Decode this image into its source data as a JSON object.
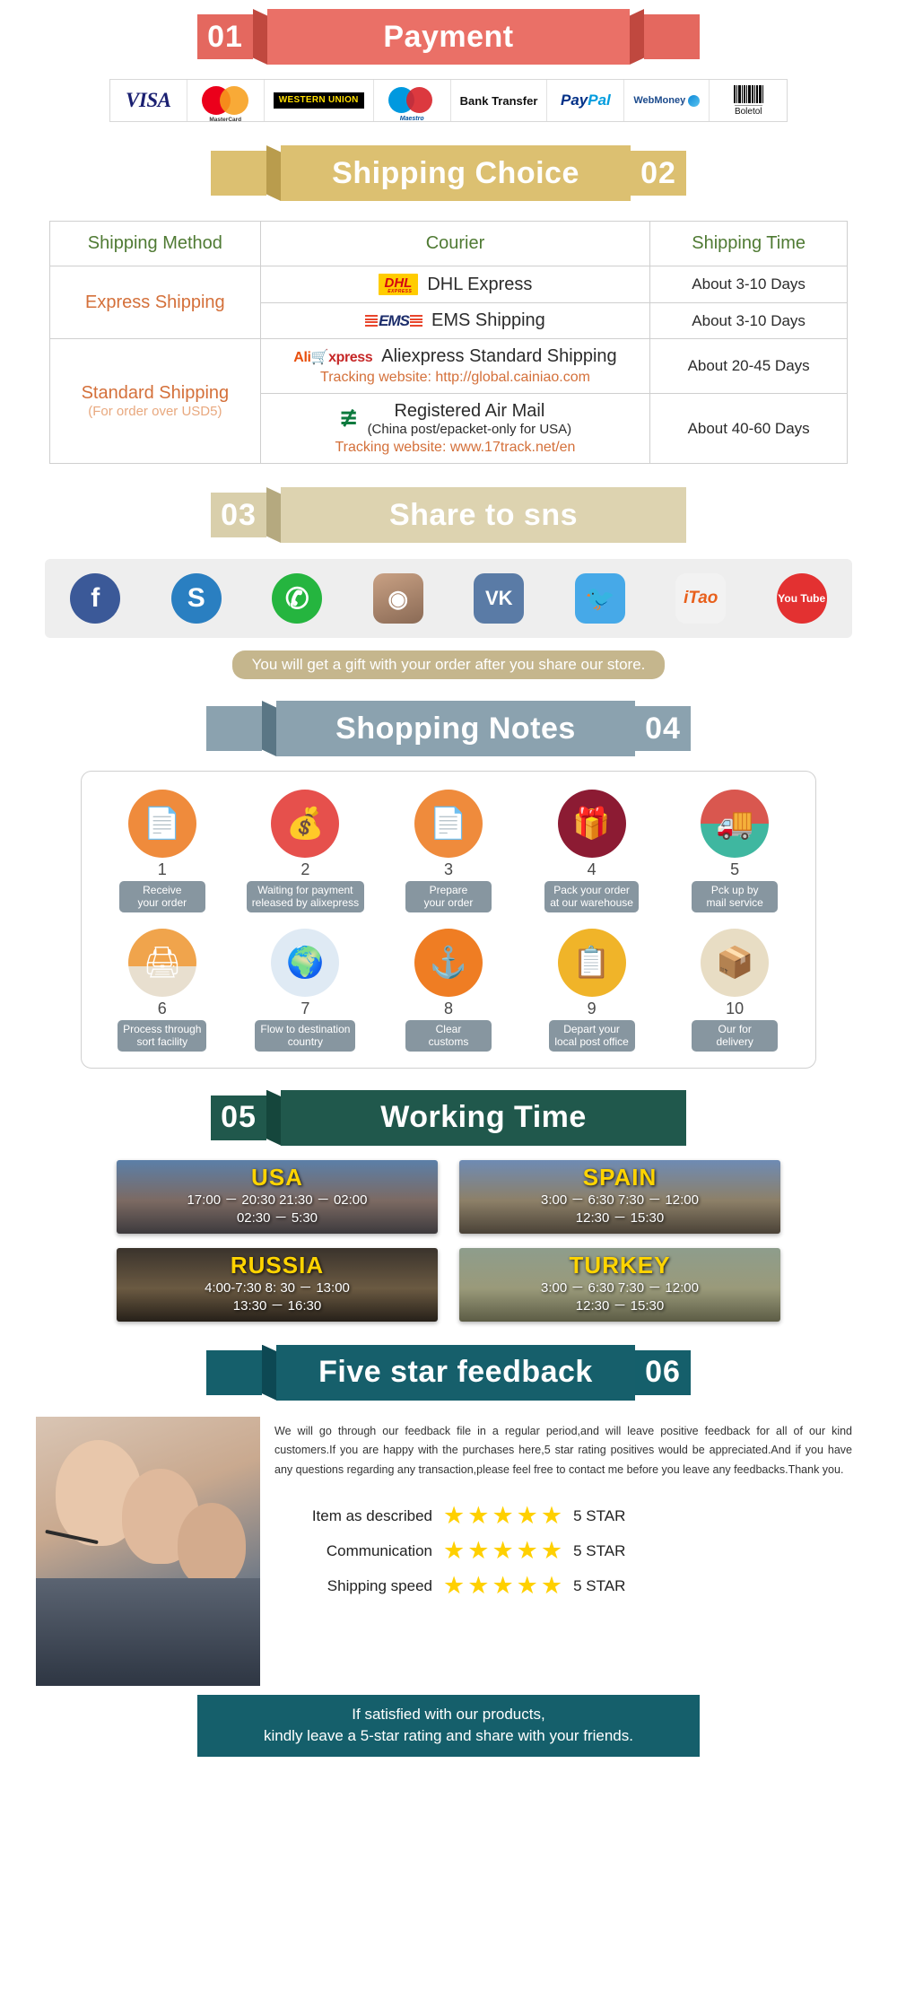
{
  "sections": {
    "payment": {
      "number": "01",
      "title": "Payment",
      "methods": [
        {
          "name": "visa-logo",
          "label": "VISA"
        },
        {
          "name": "mastercard-logo",
          "label": "MasterCard"
        },
        {
          "name": "western-union-logo",
          "label": "WESTERN UNION"
        },
        {
          "name": "maestro-logo",
          "label": "Maestro"
        },
        {
          "name": "bank-transfer-logo",
          "label": "Bank Transfer"
        },
        {
          "name": "paypal-logo",
          "label_a": "Pay",
          "label_b": "Pal"
        },
        {
          "name": "webmoney-logo",
          "label": "WebMoney"
        },
        {
          "name": "boleto-logo",
          "label": "Boletol"
        }
      ]
    },
    "shipping": {
      "number": "02",
      "title": "Shipping Choice",
      "headers": [
        "Shipping Method",
        "Courier",
        "Shipping Time"
      ],
      "groups": [
        {
          "method": "Express Shipping",
          "method_sub": "",
          "rows": [
            {
              "logo": "DHL",
              "logo_sub": "EXPRESS",
              "courier": "DHL Express",
              "courier_sub": "",
              "tracking": "",
              "time": "About 3-10 Days"
            },
            {
              "logo": "EMS",
              "logo_sub": "",
              "courier": "EMS Shipping",
              "courier_sub": "",
              "tracking": "",
              "time": "About 3-10 Days"
            }
          ]
        },
        {
          "method": "Standard Shipping",
          "method_sub": "(For order over USD5)",
          "rows": [
            {
              "logo": "AliExpress",
              "logo_sub": "",
              "courier": "Aliexpress Standard Shipping",
              "courier_sub": "",
              "tracking": "Tracking website: http://global.cainiao.com",
              "time": "About 20-45 Days"
            },
            {
              "logo": "ChinaPost",
              "logo_sub": "",
              "courier": "Registered Air Mail",
              "courier_sub": "(China post/epacket-only for USA)",
              "tracking": "Tracking website: www.17track.net/en",
              "time": "About 40-60 Days"
            }
          ]
        }
      ]
    },
    "share": {
      "number": "03",
      "title": "Share to sns",
      "networks": [
        {
          "name": "facebook-icon",
          "glyph": "f",
          "color": "#3b5998",
          "shape": "circle",
          "label": "Facebook"
        },
        {
          "name": "skype-icon",
          "glyph": "S",
          "color": "#2a7fc1",
          "shape": "circle",
          "label": "Skype"
        },
        {
          "name": "whatsapp-icon",
          "glyph": "✆",
          "color": "#25b53f",
          "shape": "circle",
          "label": "WhatsApp"
        },
        {
          "name": "instagram-icon",
          "glyph": "◉",
          "color": "#b9957a",
          "shape": "rounded",
          "label": "Instagram"
        },
        {
          "name": "vk-icon",
          "glyph": "VK",
          "color": "#5a7ba6",
          "shape": "rounded",
          "label": "VK"
        },
        {
          "name": "twitter-icon",
          "glyph": "🐦",
          "color": "#46a9e8",
          "shape": "rounded",
          "label": "Twitter"
        },
        {
          "name": "itao-icon",
          "glyph": "iTao",
          "color": "#f2f2f2",
          "shape": "rounded",
          "label": "iTao"
        },
        {
          "name": "youtube-icon",
          "glyph": "You Tube",
          "color": "#e33131",
          "shape": "circle",
          "label": "YouTube"
        }
      ],
      "gift_note": "You will get a gift with your order after you share our store."
    },
    "notes": {
      "number": "04",
      "title": "Shopping Notes",
      "steps": [
        {
          "num": "1",
          "label": "Receive\nyour order",
          "icon": "document-hand-icon",
          "color": "#ef8b3c",
          "glyph": "📄"
        },
        {
          "num": "2",
          "label": "Waiting for payment\nreleased by alixepress",
          "icon": "money-bag-icon",
          "color": "#e6504c",
          "glyph": "💰"
        },
        {
          "num": "3",
          "label": "Prepare\nyour order",
          "icon": "document-hand-icon",
          "color": "#ef8b3c",
          "glyph": "📄"
        },
        {
          "num": "4",
          "label": "Pack your order\nat our warehouse",
          "icon": "gift-box-icon",
          "color": "#8c1b33",
          "glyph": "🎁"
        },
        {
          "num": "5",
          "label": "Pck up by\nmail service",
          "icon": "mail-truck-icon",
          "color": "#d9574f",
          "glyph": "🚚"
        },
        {
          "num": "6",
          "label": "Process through\nsort facility",
          "icon": "scanner-icon",
          "color": "#ef8b3c",
          "glyph": "🖨"
        },
        {
          "num": "7",
          "label": "Flow to destination\ncountry",
          "icon": "globe-plane-icon",
          "color": "#dfeaf4",
          "glyph": "🌍"
        },
        {
          "num": "8",
          "label": "Clear\ncustoms",
          "icon": "anchor-icon",
          "color": "#ef7d23",
          "glyph": "⚓"
        },
        {
          "num": "9",
          "label": "Depart your\nlocal post office",
          "icon": "postman-icon",
          "color": "#f0b429",
          "glyph": "📋"
        },
        {
          "num": "10",
          "label": "Our for\ndelivery",
          "icon": "parcel-icon",
          "color": "#e8ddc4",
          "glyph": "📦"
        }
      ]
    },
    "working_time": {
      "number": "05",
      "title": "Working Time",
      "cards": [
        {
          "country": "USA",
          "theme": "wt-usa",
          "times": "17:00 － 20:30  21:30 － 02:00\n02:30 － 5:30"
        },
        {
          "country": "SPAIN",
          "theme": "wt-spain",
          "times": "3:00 －  6:30   7:30 － 12:00\n12:30 － 15:30"
        },
        {
          "country": "RUSSIA",
          "theme": "wt-russia",
          "times": "4:00-7:30   8: 30 － 13:00\n13:30 － 16:30"
        },
        {
          "country": "TURKEY",
          "theme": "wt-turkey",
          "times": "3:00 －  6:30   7:30 －  12:00\n12:30 － 15:30"
        }
      ]
    },
    "feedback": {
      "number": "06",
      "title": "Five star feedback",
      "paragraph": "We will go through our feedback file in a regular period,and will leave positive feedback for all of our kind customers.If you are happy with the purchases here,5 star rating positives would be appreciated.And if you have any questions regarding any transaction,please feel free to contact me before you leave any feedbacks.Thank you.",
      "ratings": [
        {
          "label": "Item as described",
          "stars": 5,
          "score": "5 STAR"
        },
        {
          "label": "Communication",
          "stars": 5,
          "score": "5 STAR"
        },
        {
          "label": "Shipping speed",
          "stars": 5,
          "score": "5 STAR"
        }
      ],
      "footer_line1": "If satisfied with our products,",
      "footer_line2": "kindly leave a 5-star rating and share with your friends."
    }
  },
  "colors": {
    "payment": "#ea7067",
    "shipping": "#dcc071",
    "share": "#ddd3b0",
    "notes": "#8ba2af",
    "working_time": "#20584c",
    "feedback": "#165f6b",
    "star": "#ffd000",
    "orange_text": "#d4703a",
    "green_header": "#4f7a33"
  }
}
